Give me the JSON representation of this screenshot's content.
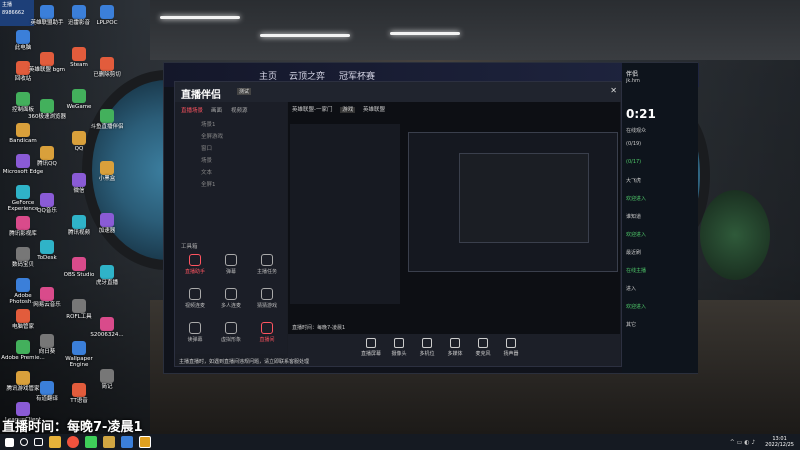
{
  "desktop": {
    "corner_logo": "主播\n8986662",
    "caption": "直播时间：每晚7-凌晨1",
    "icons": [
      [
        "此电脑",
        "8986662"
      ],
      [
        "回收站"
      ],
      [
        "控制面板"
      ],
      [
        "Bandicam"
      ],
      [
        "Microsoft Edge"
      ],
      [
        "GeForce Experience"
      ],
      [
        "腾讯影视库"
      ],
      [
        "数码宝贝"
      ],
      [
        "Adobe Photosh..."
      ],
      [
        "电脑管家"
      ],
      [
        "Adobe Premie..."
      ],
      [
        "腾讯游戏管家"
      ],
      [
        "LeagueClient"
      ],
      [
        "企业微信"
      ],
      [
        "Logitech G HUB"
      ],
      [
        "迅雷"
      ],
      [
        "WPS Office"
      ],
      [
        "驱动精灵"
      ],
      [
        "腾讯会议"
      ],
      [
        "百度网盘"
      ],
      [
        "YY语音"
      ]
    ],
    "icons_col2": [
      "英雄联盟助手",
      "英雄联盟 bgm",
      "360极速浏览器",
      "腾讯QQ",
      "QQ音乐",
      "ToDesk",
      "网易云音乐",
      "向日葵",
      "有道翻译"
    ],
    "icons_col3": [
      "迅雷影音",
      "Steam",
      "WeGame",
      "QQ",
      "微信",
      "腾讯视频",
      "OBS Studio",
      "ROFL工具",
      "Wallpaper Engine",
      "TT语音"
    ],
    "icons_col4": [
      "LPLPOC",
      "已删除剪切",
      "斗鱼直播伴侣",
      "小黑盒",
      "加速器",
      "虎牙直播",
      "S2006324...",
      "简记"
    ]
  },
  "main_window": {
    "top_tabs": [
      "主页",
      "云顶之弈",
      "冠军杯赛"
    ],
    "app_title": "直播伴侣",
    "app_badge": "测试",
    "stream_title": "英雄联盟-一家门",
    "stream_tag": "游戏",
    "category": "英雄联盟",
    "room_info": "英雄联盟 · 大神赛事",
    "room_id": "8986602",
    "sidebar_tabs": [
      "直播场景",
      "画面",
      "视频源"
    ],
    "scenes": [
      "场景1",
      "全屏游戏",
      "窗口",
      "场景",
      "文本",
      "全屏1"
    ],
    "tools_header": "工具箱",
    "tools": [
      {
        "label": "直播助手",
        "active": true
      },
      {
        "label": "弹幕",
        "active": false
      },
      {
        "label": "主播任务",
        "active": false
      },
      {
        "label": "视频连麦",
        "active": false
      },
      {
        "label": "多人连麦",
        "active": false
      },
      {
        "label": "猜猜游戏",
        "active": false
      },
      {
        "label": "读弹幕",
        "active": false
      },
      {
        "label": "虚拟形象",
        "active": false
      },
      {
        "label": "直播间",
        "active": true
      }
    ],
    "preview_label": "直播时间：每晚7-凌晨1",
    "bottom_bar": [
      "直播屏幕",
      "摄像头",
      "多机位",
      "多媒体",
      "麦克风",
      "扬声器"
    ],
    "warning": "主播直播时，如遇到直播间违规问题，请立即联系客服处理",
    "right": {
      "title": "伴侣",
      "id": "jk.hm",
      "timer": "0:21",
      "status": "在线观众",
      "lines": [
        "(0/19)",
        "(0/17)",
        "大飞虎",
        "欢迎进入",
        "谁知道",
        "欢迎进入",
        "最近刷",
        "在线主播",
        "进入",
        "欢迎进入",
        "其它"
      ]
    }
  },
  "taskbar": {
    "time": "13:01",
    "date": "2022/12/25"
  },
  "colors": {
    "accent": "#ff5460",
    "taskbar": "#151a22",
    "window_bg": "#10131b"
  }
}
